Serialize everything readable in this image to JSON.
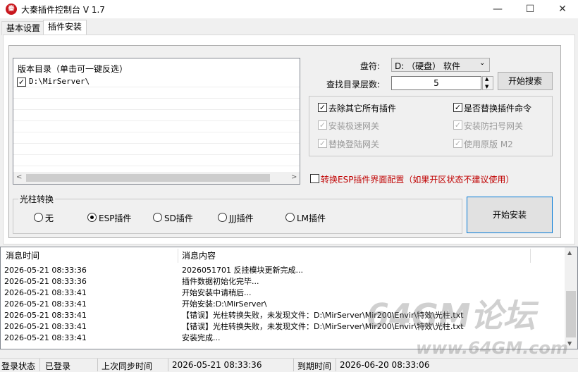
{
  "window": {
    "title": "大秦插件控制台 V 1.7",
    "minimize": "—",
    "maximize": "☐",
    "close": "✕"
  },
  "tabs": [
    {
      "label": "基本设置",
      "active": false
    },
    {
      "label": "插件安装",
      "active": true
    }
  ],
  "version_dir": {
    "header": "版本目录（单击可一键反选）",
    "items": [
      {
        "label": "D:\\MirServer\\",
        "checked": true
      }
    ]
  },
  "drive": {
    "label": "盘符:",
    "value": "D: （硬盘） 软件"
  },
  "depth": {
    "label": "查找目录层数:",
    "value": "5"
  },
  "search_button": "开始搜索",
  "options": {
    "remove_other": {
      "label": "去除其它所有插件",
      "checked": true
    },
    "replace_cmd": {
      "label": "是否替换插件命令",
      "checked": true
    },
    "install_fast_gw": {
      "label": "安装极速网关",
      "checked": true
    },
    "install_anti_scan": {
      "label": "安装防扫号网关",
      "checked": true
    },
    "replace_login_gw": {
      "label": "替换登陆网关",
      "checked": true
    },
    "use_original_m2": {
      "label": "使用原版 M2",
      "checked": true
    }
  },
  "esp_convert": {
    "label": "转换ESP插件界面配置（如果开区状态不建议使用）",
    "checked": false
  },
  "light_pillar": {
    "title": "光柱转换",
    "options": [
      "无",
      "ESP插件",
      "SD插件",
      "JJJ插件",
      "LM插件"
    ],
    "selected": 1
  },
  "install_button": "开始安装",
  "log": {
    "col_time": "消息时间",
    "col_msg": "消息内容",
    "rows": [
      {
        "time": "2026-05-21 08:33:36",
        "msg": "2026051701 反挂模块更新完成..."
      },
      {
        "time": "2026-05-21 08:33:36",
        "msg": "插件数据初始化完毕..."
      },
      {
        "time": "2026-05-21 08:33:41",
        "msg": "开始安装中请稍后..."
      },
      {
        "time": "2026-05-21 08:33:41",
        "msg": "开始安装:D:\\MirServer\\"
      },
      {
        "time": "2026-05-21 08:33:41",
        "msg": "【错误】光柱转换失败，未发现文件：D:\\MirServer\\Mir200\\Envir\\特效\\光柱.txt"
      },
      {
        "time": "2026-05-21 08:33:41",
        "msg": "【错误】光柱转换失败，未发现文件：D:\\MirServer\\Mir200\\Envir\\特效\\光柱.txt"
      },
      {
        "time": "2026-05-21 08:33:41",
        "msg": "安装完成..."
      }
    ]
  },
  "status": {
    "login_label": "登录状态",
    "login_value": "已登录",
    "sync_label": "上次同步时间",
    "sync_value": "2026-05-21 08:33:36",
    "expire_label": "到期时间",
    "expire_value": "2026-06-20 08:33:06"
  },
  "watermark": {
    "text": "64GM论坛",
    "url": "www.64GM.com"
  },
  "colors": {
    "accent": "#0078d7",
    "warn_text": "#c00000"
  }
}
